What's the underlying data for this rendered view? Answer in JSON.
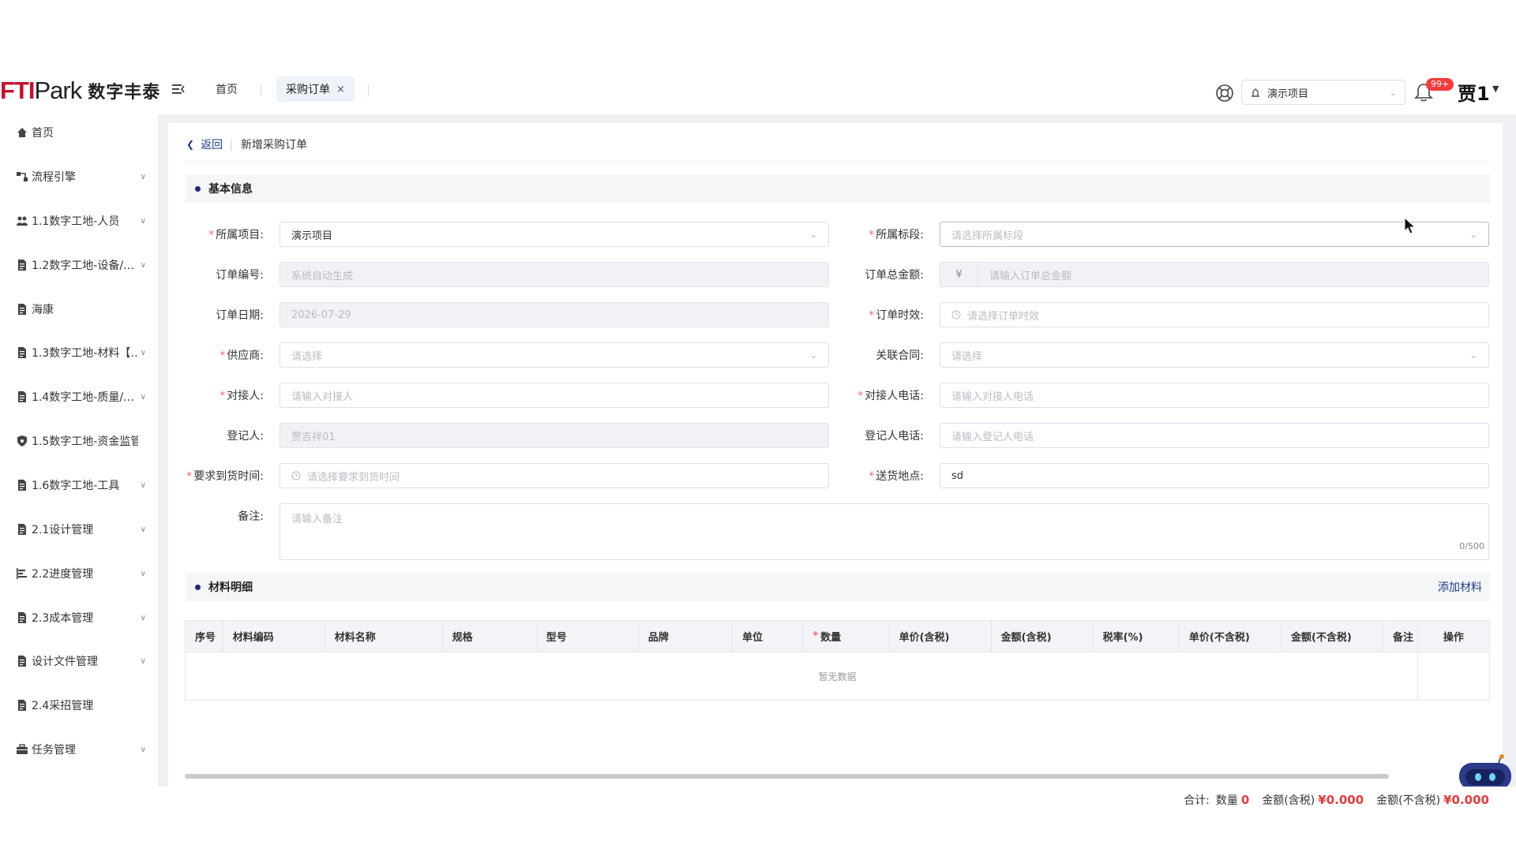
{
  "brand": {
    "logo_text_red": "FTI",
    "logo_text_dark": "Park",
    "slogan": "数字丰泰"
  },
  "header": {
    "tabs": [
      {
        "label": "首页"
      },
      {
        "label": "采购订单",
        "close": "×"
      }
    ],
    "project_select": "演示项目",
    "notification_badge": "99+",
    "username": "贾1"
  },
  "sidebar": {
    "items": [
      {
        "label": "首页",
        "icon": "home-icon",
        "expandable": false
      },
      {
        "label": "流程引擎",
        "icon": "workflow-icon",
        "expandable": true
      },
      {
        "label": "1.1数字工地-人员",
        "icon": "people-icon",
        "expandable": true
      },
      {
        "label": "1.2数字工地-设备/…",
        "icon": "document-icon",
        "expandable": true
      },
      {
        "label": "海康",
        "icon": "document-icon",
        "expandable": false
      },
      {
        "label": "1.3数字工地-材料【…",
        "icon": "document-icon",
        "expandable": true
      },
      {
        "label": "1.4数字工地-质量/…",
        "icon": "document-icon",
        "expandable": true
      },
      {
        "label": "1.5数字工地-资金监管",
        "icon": "shield-icon",
        "expandable": false
      },
      {
        "label": "1.6数字工地-工具",
        "icon": "document-icon",
        "expandable": true
      },
      {
        "label": "2.1设计管理",
        "icon": "document-icon",
        "expandable": true
      },
      {
        "label": "2.2进度管理",
        "icon": "gantt-icon",
        "expandable": true
      },
      {
        "label": "2.3成本管理",
        "icon": "document-icon",
        "expandable": true
      },
      {
        "label": "设计文件管理",
        "icon": "document-icon",
        "expandable": true
      },
      {
        "label": "2.4采招管理",
        "icon": "document-icon",
        "expandable": false
      },
      {
        "label": "任务管理",
        "icon": "briefcase-icon",
        "expandable": true
      }
    ]
  },
  "page": {
    "back_label": "返回",
    "title": "新增采购订单",
    "basic_section": "基本信息",
    "material_section": "材料明细",
    "add_material": "添加材料"
  },
  "form": {
    "project": {
      "label": "所属项目:",
      "value": "演示项目"
    },
    "segment": {
      "label": "所属标段:",
      "placeholder": "请选择所属标段"
    },
    "order_no": {
      "label": "订单编号:",
      "placeholder": "系统自动生成"
    },
    "total": {
      "label": "订单总金额:",
      "currency": "¥",
      "placeholder": "请输入订单总金额"
    },
    "order_date": {
      "label": "订单日期:",
      "value": "2026-07-29"
    },
    "validity": {
      "label": "订单时效:",
      "placeholder": "请选择订单时效"
    },
    "supplier": {
      "label": "供应商:",
      "placeholder": "请选择"
    },
    "contract": {
      "label": "关联合同:",
      "placeholder": "请选择"
    },
    "contact": {
      "label": "对接人:",
      "placeholder": "请输入对接人"
    },
    "contact_phone": {
      "label": "对接人电话:",
      "placeholder": "请输入对接人电话"
    },
    "registrar": {
      "label": "登记人:",
      "value": "贾吉祥01"
    },
    "registrar_phone": {
      "label": "登记人电话:",
      "placeholder": "请输入登记人电话"
    },
    "arrival_time": {
      "label": "要求到货时间:",
      "placeholder": "请选择要求到货时间"
    },
    "delivery_place": {
      "label": "送货地点:",
      "value": "sd"
    },
    "remark": {
      "label": "备注:",
      "placeholder": "请输入备注",
      "counter": "0/500"
    }
  },
  "table": {
    "columns": [
      "序号",
      "材料编码",
      "材料名称",
      "规格",
      "型号",
      "品牌",
      "单位",
      "数量",
      "单价(含税)",
      "金额(含税)",
      "税率(%)",
      "单价(不含税)",
      "金额(不含税)",
      "备注",
      "操作"
    ],
    "empty_text": "暂无数据"
  },
  "summary": {
    "label": "合计:",
    "qty_label": "数量",
    "qty": "0",
    "amt_tax_label": "金额(含税)",
    "amt_tax": "¥0.000",
    "amt_notax_label": "金额(不含税)",
    "amt_notax": "¥0.000"
  },
  "colors": {
    "accent": "#1f2a7a",
    "link": "#1f3c88",
    "danger": "#e23b3b",
    "brand_red": "#c8102e"
  }
}
